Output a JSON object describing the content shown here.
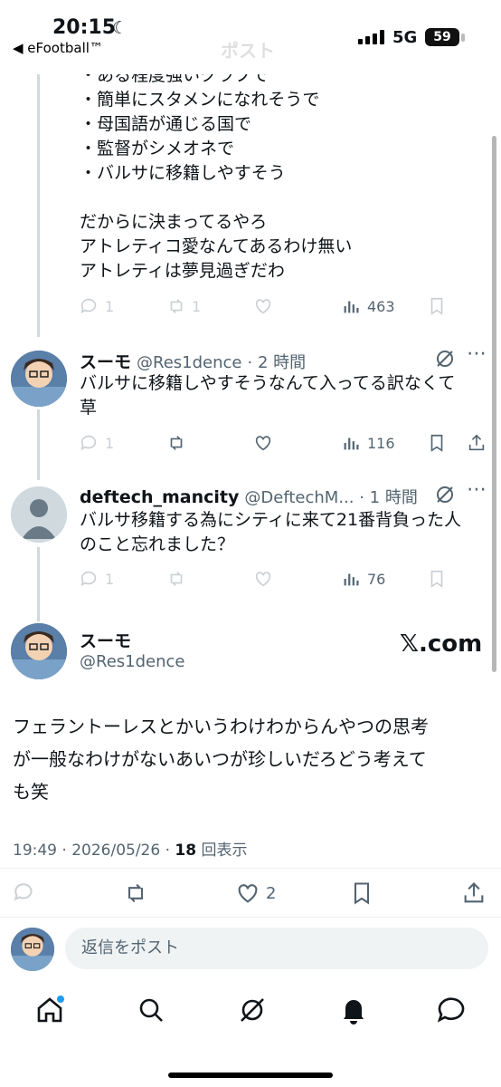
{
  "status_bar": {
    "time": "20:15",
    "back_app": "◀ eFootball™",
    "network": "5G",
    "battery": "59"
  },
  "header": {
    "title": "ポスト"
  },
  "prev_post": {
    "lines": [
      "・ある程度強いクラブで",
      "・簡単にスタメンになれそうで",
      "・母国語が通じる国で",
      "・監督がシメオネで",
      "・バルサに移籍しやすそう",
      "",
      "だからに決まってるやろ",
      "アトレティコ愛なんてあるわけ無い",
      "アトレティは夢見過ぎだわ"
    ],
    "reply_count": "1",
    "repost_count": "1",
    "views": "463"
  },
  "reply1": {
    "display_name": "スーモ",
    "handle": "@Res1dence",
    "time": "· 2 時間",
    "text_lines": [
      "バルサに移籍しやすそうなんて入ってる訳なくて",
      "草"
    ],
    "reply_count": "1",
    "views": "116"
  },
  "reply2": {
    "display_name": "deftech_mancity",
    "handle": "@DeftechM... · 1 時間",
    "text_lines": [
      "バルサ移籍する為にシティに来て21番背負った人",
      "のこと忘れました？"
    ],
    "reply_count": "1",
    "views": "76"
  },
  "main_post": {
    "display_name": "スーモ",
    "handle": "@Res1dence",
    "watermark": "𝕏.com",
    "text_lines": [
      "フェラントーレスとかいうわけわからんやつの思考",
      "が一般なわけがないあいつが珍しいだろどう考えて",
      "も笑"
    ],
    "timestamp": "19:49 · 2026/05/26 · ",
    "views_count": "18",
    "views_label": " 回表示",
    "like_count": "2"
  },
  "reply_box": {
    "placeholder": "返信をポスト"
  },
  "colors": {
    "text": "#0f1419",
    "muted": "#536471",
    "line": "#cfd9de",
    "accent": "#1d9bf0"
  }
}
